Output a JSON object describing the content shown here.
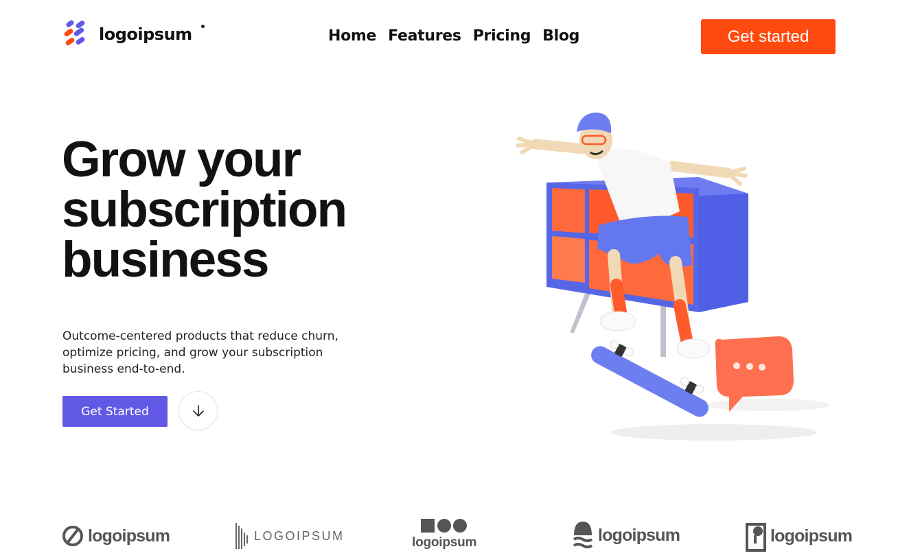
{
  "header": {
    "brand": {
      "name": "logoipsum",
      "icon": "logo-mark-icon"
    },
    "nav": [
      {
        "label": "Home"
      },
      {
        "label": "Features"
      },
      {
        "label": "Pricing"
      },
      {
        "label": "Blog"
      }
    ],
    "cta_label": "Get started"
  },
  "hero": {
    "title_lines": [
      "Grow your",
      "subscription",
      "business"
    ],
    "subtitle": "Outcome-centered products that reduce churn, optimize pricing, and grow your subscription business end-to-end.",
    "primary_button": "Get Started",
    "scroll_icon": "arrow-down-icon",
    "illustration": "skater-illustration"
  },
  "partner_logos": [
    {
      "name": "logoipsum",
      "icon": "circle-slash-logo-icon"
    },
    {
      "name": "LOGOIPSUM",
      "icon": "barcode-logo-icon"
    },
    {
      "name": "logoipsum",
      "icon": "shapes-logo-icon"
    },
    {
      "name": "logoipsum",
      "icon": "wave-dome-logo-icon"
    },
    {
      "name": "logoipsum",
      "icon": "square-pin-logo-icon"
    }
  ],
  "colors": {
    "accent_orange": "#ff4a0f",
    "primary_purple": "#6159e6",
    "text": "#121212",
    "shelf_blue": "#5567e6",
    "shelf_orange": "#ff6a3d"
  }
}
